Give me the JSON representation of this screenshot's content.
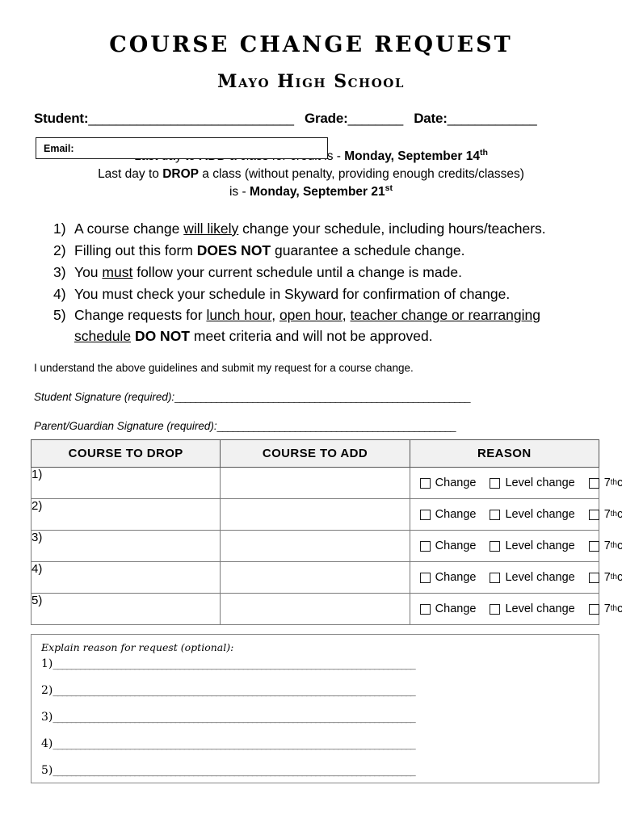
{
  "document": {
    "title": "COURSE CHANGE REQUEST",
    "subtitle": "Mayo High School"
  },
  "identity": {
    "student_label": "Student:",
    "student_rule": "______________________________",
    "grade_label": "Grade:",
    "grade_rule": "________",
    "date_label": "Date:",
    "date_rule": "_____________"
  },
  "email_field": {
    "label": "Email:",
    "value": "",
    "placeholder": ""
  },
  "deadlines": [
    {
      "pre": "Last day to ",
      "bold1": "ADD",
      "mid": " a class for credit is - ",
      "bold2": "Monday, September 14",
      "sup": "th",
      "post": ""
    },
    {
      "pre": "Last day to ",
      "bold1": "DROP",
      "mid": " a class (without penalty, providing enough credits/classes)",
      "bold2": "",
      "sup": "",
      "post": ""
    },
    {
      "pre": "is - ",
      "bold1": "",
      "mid": "",
      "bold2": "Monday, September 21",
      "sup": "st",
      "post": ""
    }
  ],
  "guidelines": [
    {
      "num": "1)",
      "text_plain": "A course change will likely change your schedule, including hours/teachers."
    },
    {
      "num": "2)",
      "text_plain": "Filling out this form DOES NOT guarantee a schedule change."
    },
    {
      "num": "3)",
      "text_plain": "You must follow your current schedule until a change is made."
    },
    {
      "num": "4)",
      "text_plain": "You must check your schedule in Skyward for confirmation of change."
    },
    {
      "num": "5)",
      "text_plain": "Change requests for lunch hour, open hour, teacher change or rearranging schedule DO NOT meet criteria and will not be approved."
    }
  ],
  "acknowledgement": "I understand the above guidelines and submit my request for a course change.",
  "signatures": [
    {
      "label": "Student Signature (required):",
      "rule": "_________________________________________________________"
    },
    {
      "label": "Parent/Guardian Signature (required):",
      "rule": "______________________________________________"
    }
  ],
  "table": {
    "headers": [
      "COURSE TO DROP",
      "COURSE TO ADD",
      "REASON"
    ],
    "rows": [
      {
        "number": "1)",
        "course_to_drop": "",
        "course_to_add": ""
      },
      {
        "number": "2)",
        "course_to_drop": "",
        "course_to_add": ""
      },
      {
        "number": "3)",
        "course_to_drop": "",
        "course_to_add": ""
      },
      {
        "number": "4)",
        "course_to_drop": "",
        "course_to_add": ""
      },
      {
        "number": "5)",
        "course_to_drop": "",
        "course_to_add": ""
      }
    ],
    "reason_options": [
      {
        "label": "Change",
        "checked": false
      },
      {
        "label": "Level change",
        "checked": false
      },
      {
        "label": "7",
        "sup": "th",
        "label_tail": " class",
        "checked": false
      }
    ]
  },
  "explain": {
    "label": "Explain reason for request (optional):",
    "lines": [
      {
        "num": "1)",
        "rule": "________________________________________________________________________________"
      },
      {
        "num": "2)",
        "rule": "________________________________________________________________________________"
      },
      {
        "num": "3)",
        "rule": "________________________________________________________________________________"
      },
      {
        "num": "4)",
        "rule": "________________________________________________________________________________"
      },
      {
        "num": "5)",
        "rule": "________________________________________________________________________________"
      }
    ]
  },
  "colors": {
    "text": "#000000",
    "header_fill": "#f1f1f1",
    "border": "#7b7b7b",
    "rule": "#2b2b2b"
  }
}
